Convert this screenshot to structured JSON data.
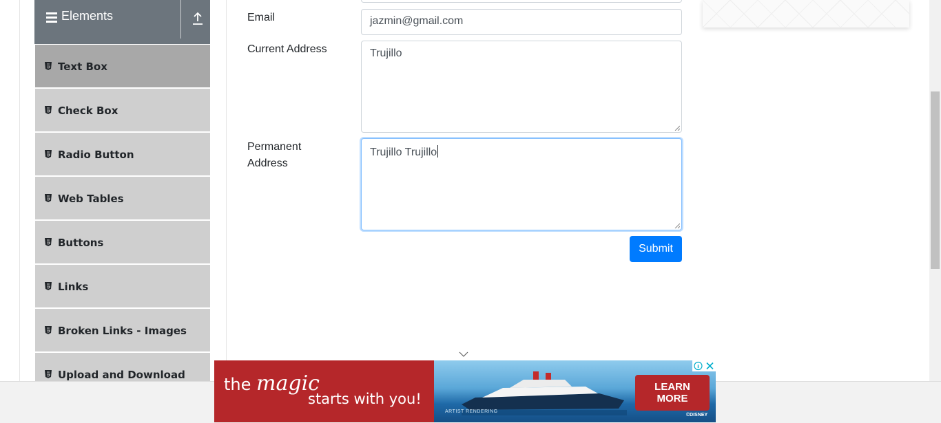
{
  "sidebar": {
    "group_title": "Elements",
    "items": [
      {
        "label": "Text Box",
        "active": true
      },
      {
        "label": "Check Box"
      },
      {
        "label": "Radio Button"
      },
      {
        "label": "Web Tables"
      },
      {
        "label": "Buttons"
      },
      {
        "label": "Links"
      },
      {
        "label": "Broken Links - Images"
      },
      {
        "label": "Upload and Download"
      }
    ]
  },
  "form": {
    "email_label": "Email",
    "email_value": "jazmin@gmail.com",
    "current_address_label": "Current Address",
    "current_address_value": "Trujillo",
    "permanent_address_label_line1": "Permanent",
    "permanent_address_label_line2": "Address",
    "permanent_address_value": "Trujillo Trujillo",
    "submit_label": "Submit"
  },
  "ad": {
    "line1_pre": "the",
    "line1_magic": "magic",
    "line2": "starts with you!",
    "cta_line1": "LEARN",
    "cta_line2": "MORE",
    "artist": "ARTIST RENDERING",
    "brand": "©DISNEY"
  },
  "colors": {
    "primary": "#007bff",
    "sidebar_header": "#6c757d",
    "sidebar_item": "#cfcfcf",
    "sidebar_item_active": "#a8a8a8",
    "ad_red": "#b5272a"
  },
  "icons": {
    "group": "hamburger-icon",
    "collapse": "upload-arrow-icon",
    "item": "html5-icon",
    "chevron": "chevron-down-icon"
  }
}
